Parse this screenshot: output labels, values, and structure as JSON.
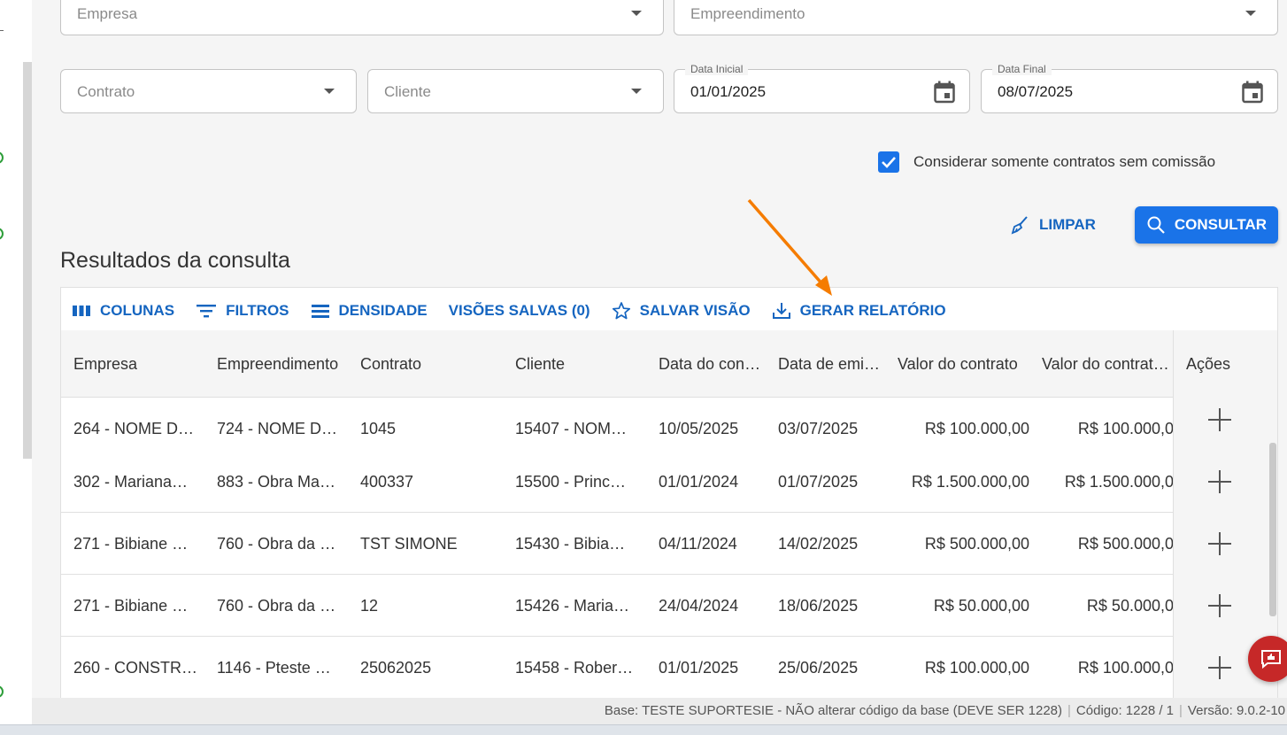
{
  "filters": {
    "empresa_placeholder": "Empresa",
    "empreendimento_placeholder": "Empreendimento",
    "contrato_placeholder": "Contrato",
    "cliente_placeholder": "Cliente",
    "data_inicial_label": "Data Inicial",
    "data_inicial_value": "01/01/2025",
    "data_final_label": "Data Final",
    "data_final_value": "08/07/2025",
    "checkbox_label": "Considerar somente contratos sem comissão",
    "checkbox_checked": true
  },
  "actions": {
    "limpar_label": "LIMPAR",
    "consultar_label": "CONSULTAR"
  },
  "results": {
    "title": "Resultados da consulta",
    "toolbar": {
      "colunas": "COLUNAS",
      "filtros": "FILTROS",
      "densidade": "DENSIDADE",
      "visoes_salvas": "VISÕES SALVAS (0)",
      "salvar_visao": "SALVAR VISÃO",
      "gerar_relatorio": "GERAR RELATÓRIO"
    },
    "columns": [
      "Empresa",
      "Empreendimento",
      "Contrato",
      "Cliente",
      "Data do con…",
      "Data de emi…",
      "Valor do contrato",
      "Valor do contrat…",
      "Ações"
    ],
    "rows": [
      [
        "264 - NOME D…",
        "724 - NOME D…",
        "1045",
        "15407 - NOM…",
        "10/05/2025",
        "03/07/2025",
        "R$ 100.000,00",
        "R$ 100.000,0"
      ],
      [
        "302 - Mariana…",
        "883 - Obra Ma…",
        "400337",
        "15500 - Princ…",
        "01/01/2024",
        "01/07/2025",
        "R$ 1.500.000,00",
        "R$ 1.500.000,0"
      ],
      [
        "271 - Bibiane …",
        "760 - Obra da …",
        "TST SIMONE",
        "15430 - Bibia…",
        "04/11/2024",
        "14/02/2025",
        "R$ 500.000,00",
        "R$ 500.000,0"
      ],
      [
        "271 - Bibiane …",
        "760 - Obra da …",
        "12",
        "15426 - Maria…",
        "24/04/2024",
        "18/06/2025",
        "R$ 50.000,00",
        "R$ 50.000,0"
      ],
      [
        "260 - CONSTR…",
        "1146 - Pteste …",
        "25062025",
        "15458 - Rober…",
        "01/01/2025",
        "25/06/2025",
        "R$ 100.000,00",
        "R$ 100.000,0"
      ]
    ]
  },
  "footer": {
    "base": "Base: TESTE SUPORTESIE - NÃO alterar código da base (DEVE SER 1228)",
    "codigo": "Código: 1228 / 1",
    "versao": "Versão: 9.0.2-10"
  },
  "colors": {
    "primary": "#1a73e8",
    "link": "#1565c0",
    "annotation_arrow": "#f57c00",
    "fab": "#c62828"
  }
}
